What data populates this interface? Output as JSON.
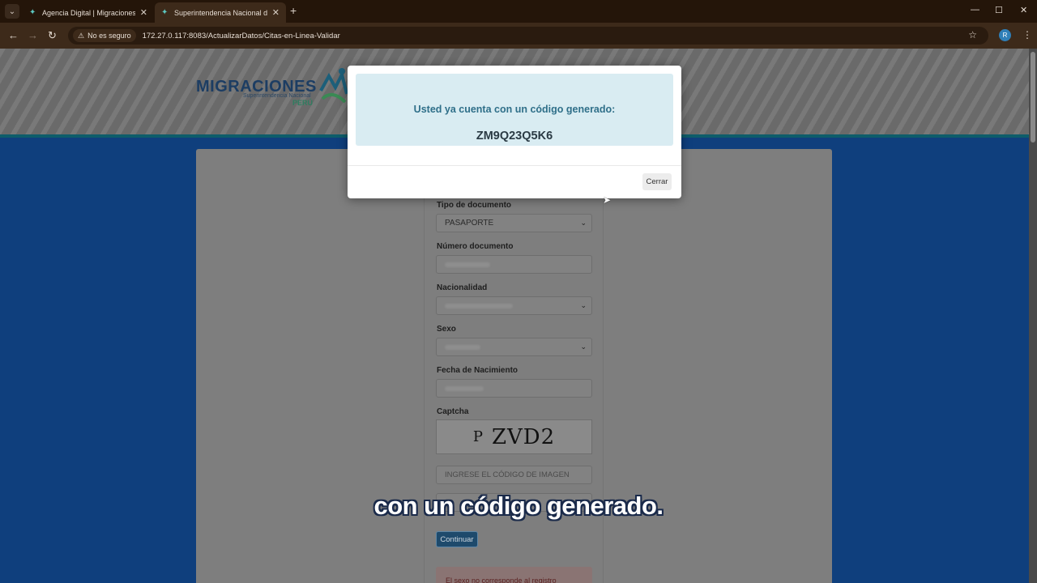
{
  "browser": {
    "tabs": [
      {
        "title": "Agencia Digital | Migraciones",
        "active": false
      },
      {
        "title": "Superintendencia Nacional de M",
        "active": true
      }
    ],
    "security_label": "No es seguro",
    "url": "172.27.0.117:8083/ActualizarDatos/Citas-en-Linea-Validar",
    "profile_initial": "R"
  },
  "header": {
    "logo_word": "MIGRACIONES",
    "logo_sub": "Superintendencia Nacional",
    "logo_country": "PERÚ"
  },
  "form": {
    "tipo_documento": {
      "label": "Tipo de documento",
      "value": "PASAPORTE"
    },
    "numero_documento": {
      "label": "Número documento"
    },
    "nacionalidad": {
      "label": "Nacionalidad"
    },
    "sexo": {
      "label": "Sexo"
    },
    "fecha_nacimiento": {
      "label": "Fecha de Nacimiento"
    },
    "captcha": {
      "label": "Captcha",
      "image_text_prefix": "P",
      "image_text": "ZVD2"
    },
    "captcha_input": {
      "placeholder": "INGRESE EL CÓDIGO DE IMAGEN"
    },
    "continue_label": "Continuar",
    "error_text": "El sexo no corresponde al registro"
  },
  "modal": {
    "message": "Usted ya cuenta con un código generado:",
    "code": "ZM9Q23Q5K6",
    "close_label": "Cerrar"
  },
  "subtitle": "con un código generado."
}
